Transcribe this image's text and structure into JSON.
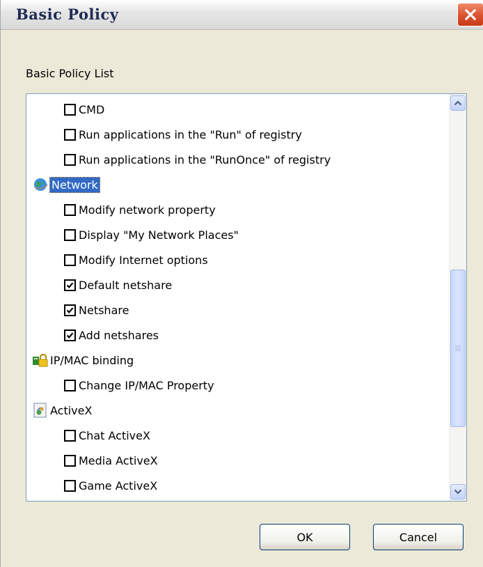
{
  "window": {
    "title": "Basic Policy",
    "close_icon": "close-icon"
  },
  "group_label": "Basic Policy List",
  "list": [
    {
      "type": "option",
      "label": "CMD",
      "checked": false
    },
    {
      "type": "option",
      "label": "Run applications in the \"Run\"  of registry",
      "checked": false
    },
    {
      "type": "option",
      "label": "Run applications in the \"RunOnce\" of registry",
      "checked": false
    },
    {
      "type": "category",
      "label": "Network",
      "icon": "network-globe-icon",
      "selected": true
    },
    {
      "type": "option",
      "label": "Modify network property",
      "checked": false
    },
    {
      "type": "option",
      "label": "Display \"My Network Places\"",
      "checked": false
    },
    {
      "type": "option",
      "label": "Modify Internet options",
      "checked": false
    },
    {
      "type": "option",
      "label": "Default netshare",
      "checked": true
    },
    {
      "type": "option",
      "label": "Netshare",
      "checked": true
    },
    {
      "type": "option",
      "label": "Add netshares",
      "checked": true
    },
    {
      "type": "category",
      "label": "IP/MAC binding",
      "icon": "ipmac-lock-icon"
    },
    {
      "type": "option",
      "label": "Change IP/MAC Property",
      "checked": false
    },
    {
      "type": "category",
      "label": "ActiveX",
      "icon": "activex-icon"
    },
    {
      "type": "option",
      "label": "Chat ActiveX",
      "checked": false
    },
    {
      "type": "option",
      "label": "Media ActiveX",
      "checked": false
    },
    {
      "type": "option",
      "label": "Game ActiveX",
      "checked": false
    }
  ],
  "buttons": {
    "ok": "OK",
    "cancel": "Cancel"
  },
  "colors": {
    "selection": "#316ac5",
    "close_button": "#d9512c"
  }
}
